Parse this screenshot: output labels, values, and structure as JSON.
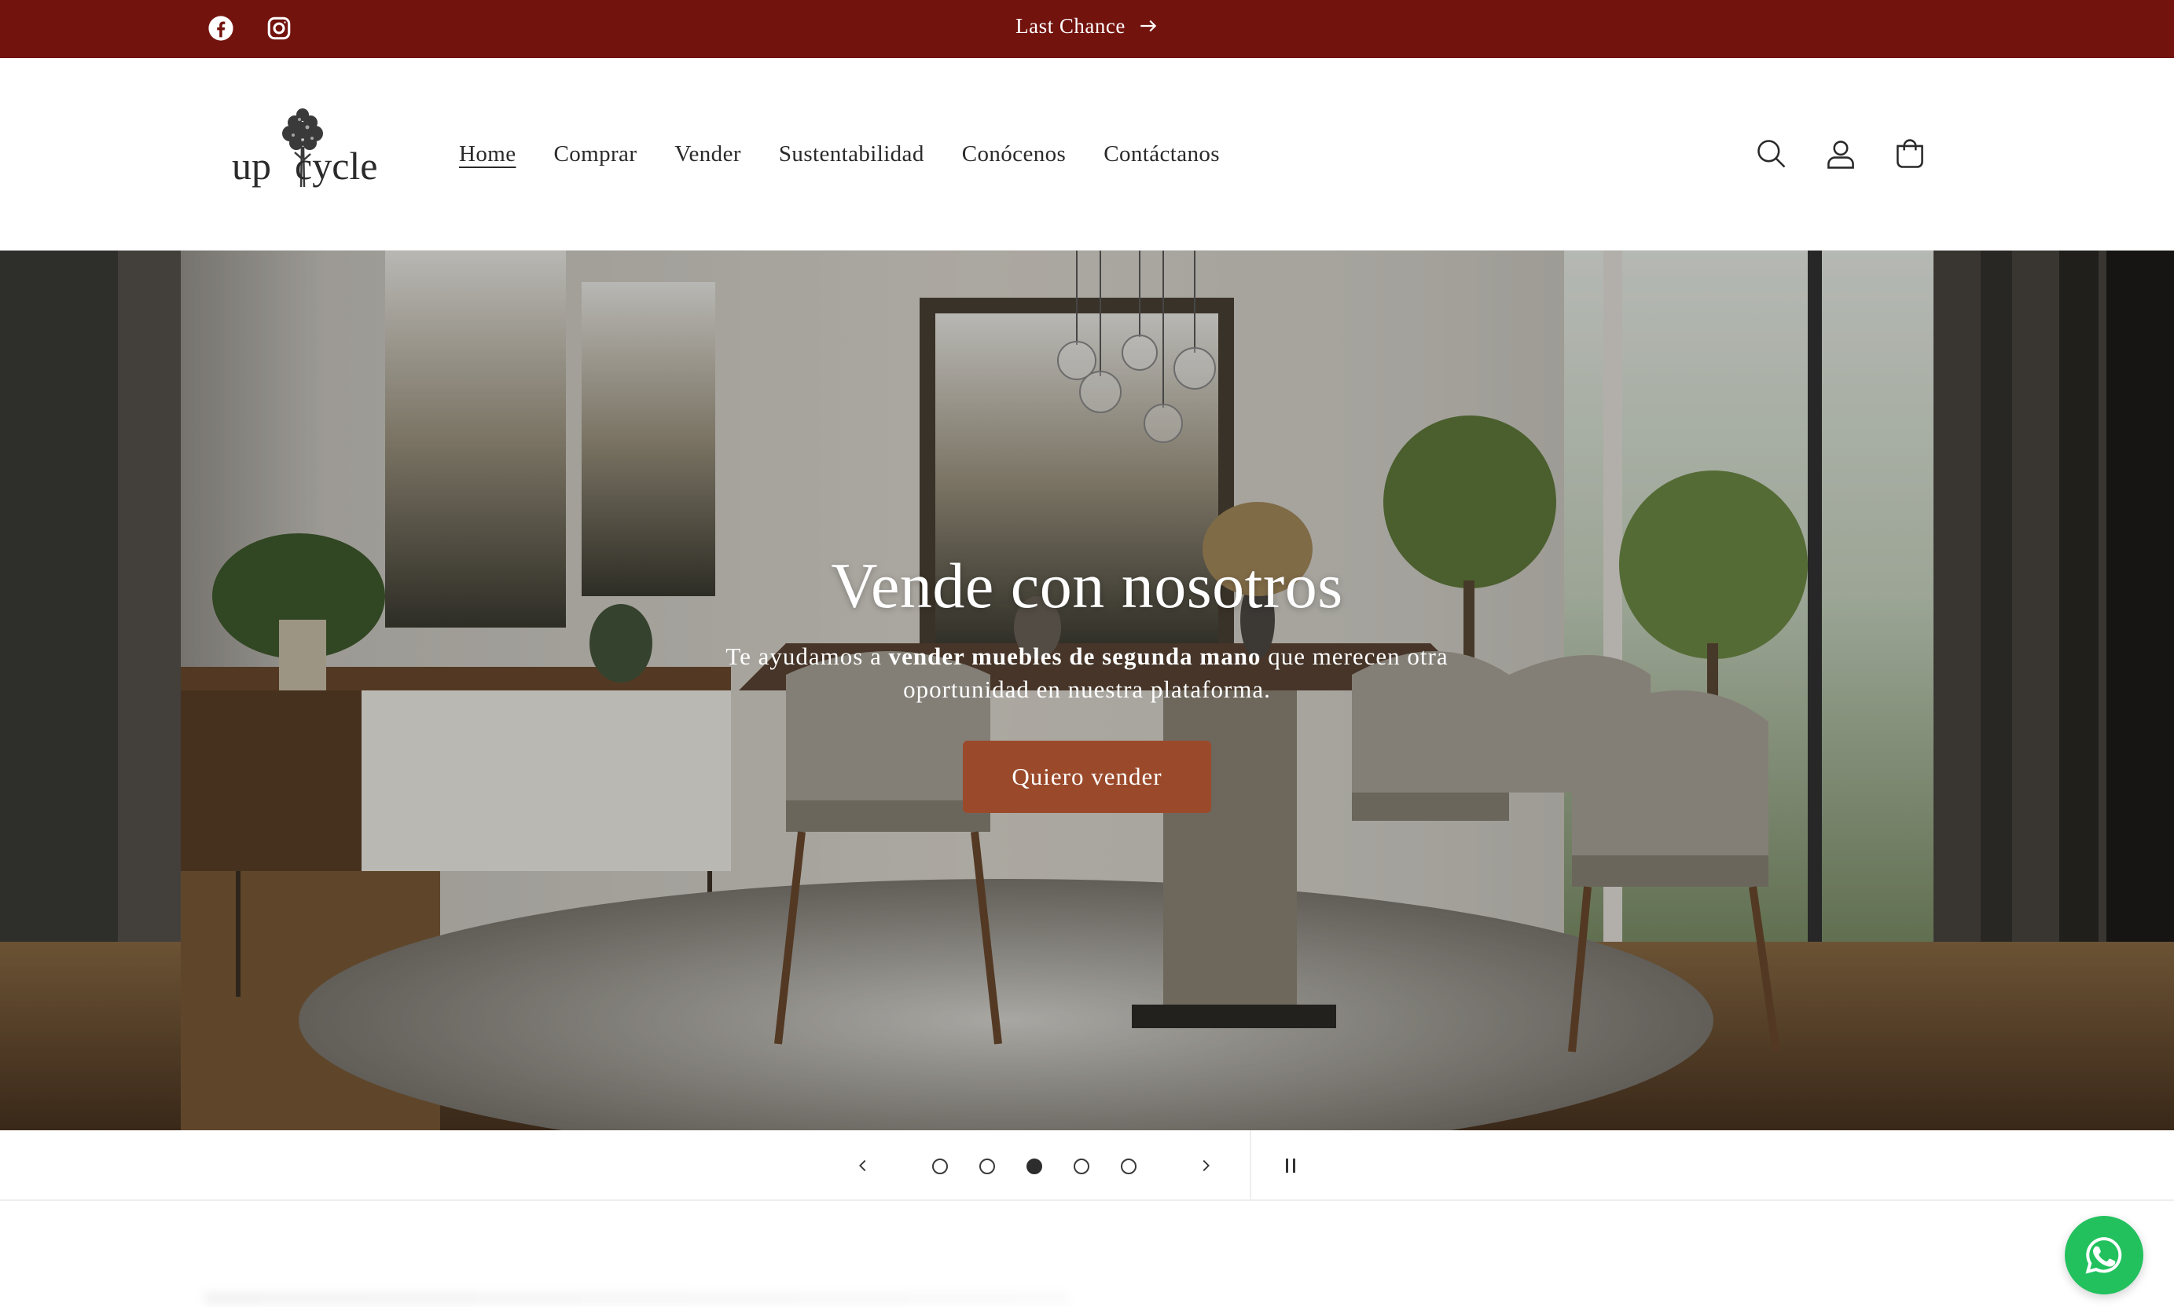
{
  "announcement": {
    "text": "Last Chance",
    "social": [
      "facebook-icon",
      "instagram-icon"
    ]
  },
  "header": {
    "logo": {
      "left": "up",
      "right": "cycle"
    },
    "nav": [
      {
        "label": "Home",
        "active": true
      },
      {
        "label": "Comprar"
      },
      {
        "label": "Vender"
      },
      {
        "label": "Sustentabilidad"
      },
      {
        "label": "Conócenos"
      },
      {
        "label": "Contáctanos"
      }
    ],
    "icons": [
      "search-icon",
      "account-icon",
      "cart-icon"
    ]
  },
  "hero": {
    "title": "Vende con nosotros",
    "text_before": "Te ayudamos a ",
    "text_bold": "vender muebles de segunda mano",
    "text_after": " que merecen otra oportunidad en nuestra plataforma.",
    "button": "Quiero vender"
  },
  "slider": {
    "slide_count": 5,
    "active_slide": 3,
    "icons": [
      "chevron-left-icon",
      "chevron-right-icon",
      "pause-icon"
    ]
  },
  "floating": {
    "icon": "whatsapp-icon"
  },
  "colors": {
    "announcement_bg": "#73130e",
    "button_bg": "#9a4a2b",
    "whatsapp": "#22c15e"
  }
}
